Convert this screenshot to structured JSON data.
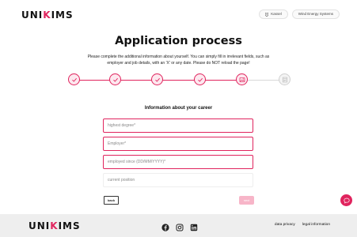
{
  "header": {
    "logo_left": "UNI",
    "logo_bracket": "K",
    "logo_right": "IMS",
    "location_label": "Kassel",
    "category_label": "Wind Energy Systems"
  },
  "page": {
    "title": "Application process",
    "subtitle": "Please complete the additional information about yourself. You can simply fill in irrelevant fields, such as employer and job details, with an 'X' or any date. Please do NOT reload the page!"
  },
  "stepper": {
    "total_steps": 6,
    "completed_steps": 4,
    "current_step": 5
  },
  "form": {
    "section_title": "Information about your career",
    "fields": {
      "highest_degree_placeholder": "highest degree*",
      "employer_placeholder": "Employer*",
      "employed_since_placeholder": "employed since (DD/MM/YYYY)*",
      "current_position_placeholder": "current position"
    },
    "back_label": "back",
    "next_label": "next"
  },
  "footer": {
    "logo_left": "UNI",
    "logo_bracket": "K",
    "logo_right": "IMS",
    "social_icons": [
      "facebook-icon",
      "instagram-icon",
      "linkedin-icon"
    ],
    "links": [
      "data privacy",
      "legal information"
    ]
  },
  "colors": {
    "accent": "#e0245e",
    "accent_light": "#fde8ef",
    "footer_bg": "#eeeeee"
  }
}
